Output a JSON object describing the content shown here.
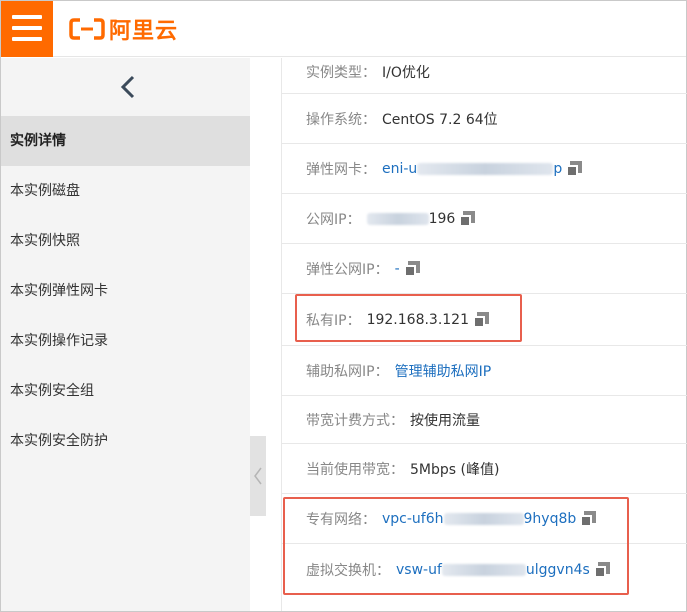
{
  "header": {
    "menu_icon": "hamburger-menu-icon",
    "logo_text": "阿里云",
    "brand_color": "#ff6a00"
  },
  "sidebar": {
    "back_icon": "chevron-left-icon",
    "items": [
      {
        "label": "实例详情",
        "active": true
      },
      {
        "label": "本实例磁盘"
      },
      {
        "label": "本实例快照"
      },
      {
        "label": "本实例弹性网卡"
      },
      {
        "label": "本实例操作记录"
      },
      {
        "label": "本实例安全组"
      },
      {
        "label": "本实例安全防护"
      }
    ]
  },
  "details": {
    "instance_type": {
      "label": "实例类型：",
      "value": "I/O优化"
    },
    "os": {
      "label": "操作系统：",
      "value": "CentOS 7.2 64位"
    },
    "eni": {
      "label": "弹性网卡：",
      "prefix": "eni-u",
      "suffix": "p"
    },
    "public_ip": {
      "label": "公网IP：",
      "suffix": "196"
    },
    "eip": {
      "label": "弹性公网IP：",
      "value": "-"
    },
    "private_ip": {
      "label": "私有IP：",
      "value": "192.168.3.121"
    },
    "secondary_ip": {
      "label": "辅助私网IP：",
      "link": "管理辅助私网IP"
    },
    "billing": {
      "label": "带宽计费方式：",
      "value": "按使用流量"
    },
    "bandwidth": {
      "label": "当前使用带宽：",
      "value": "5Mbps (峰值)"
    },
    "vpc": {
      "label": "专有网络：",
      "prefix": "vpc-uf6h",
      "suffix": "9hyq8b"
    },
    "vswitch": {
      "label": "虚拟交换机：",
      "prefix": "vsw-uf",
      "suffix": "ulggvn4s"
    }
  },
  "highlight_color": "#e85f4d",
  "link_color": "#1d6fbf"
}
